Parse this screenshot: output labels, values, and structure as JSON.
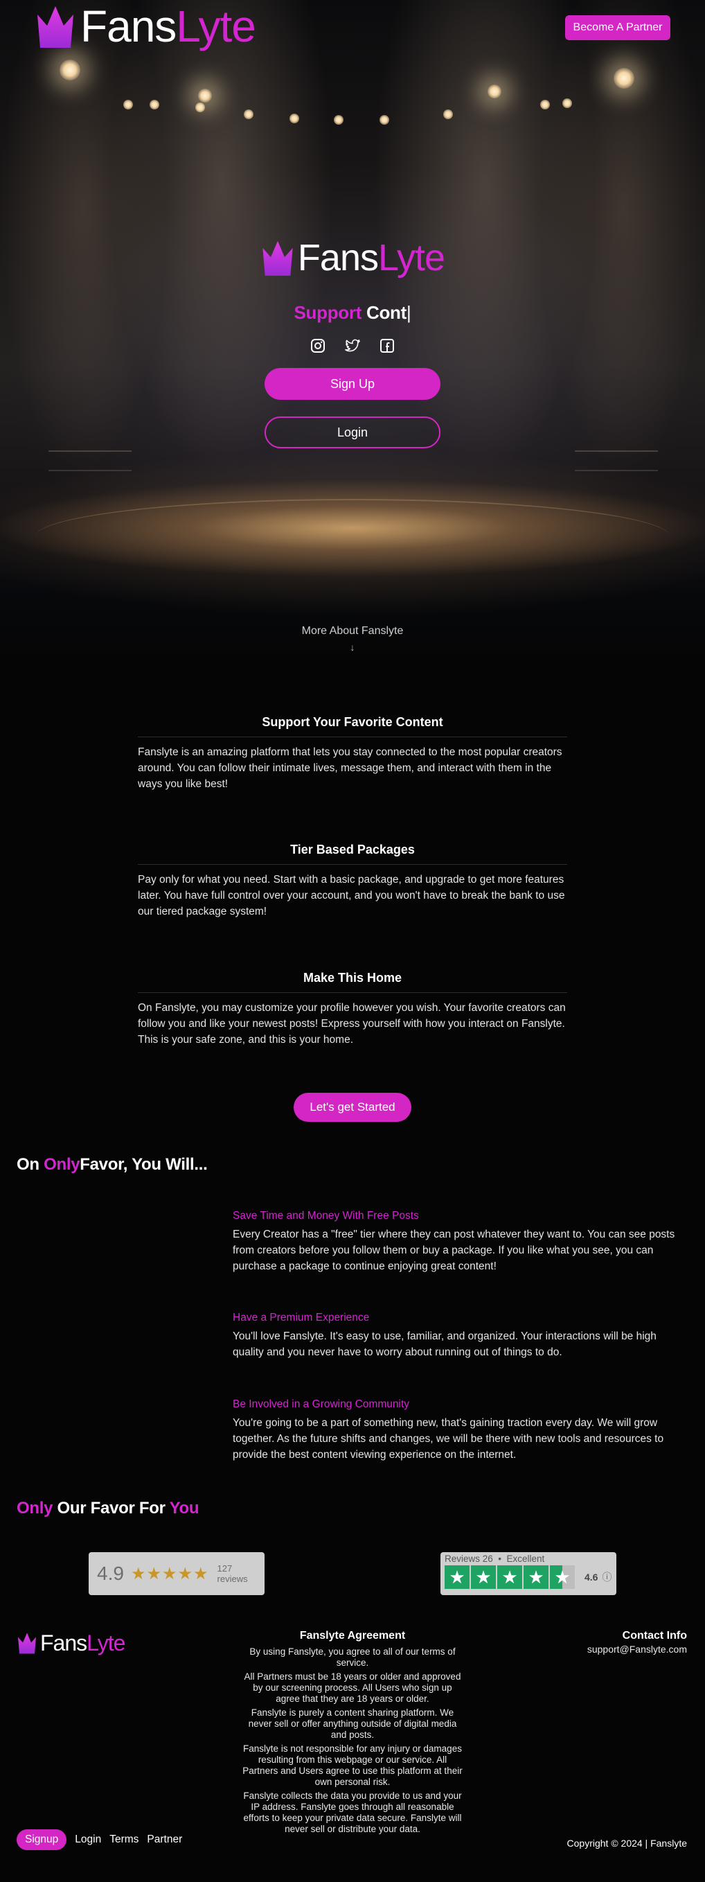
{
  "brand": {
    "part1": "Fans",
    "part2": "Lyte",
    "primary_color": "#d326c4",
    "icon": "crown-icon"
  },
  "header": {
    "partner_button": "Become A Partner"
  },
  "hero": {
    "typing_word1": "Support",
    "typing_word2": "Cont",
    "typing_caret": "|",
    "socials": [
      "instagram-icon",
      "twitter-icon",
      "facebook-icon"
    ],
    "signup_label": "Sign Up",
    "login_label": "Login",
    "more_about": "More About Fanslyte",
    "more_arrow": "↓"
  },
  "features": [
    {
      "title": "Support Your Favorite Content",
      "body": "Fanslyte is an amazing platform that lets you stay connected to the most popular creators around. You can follow their intimate lives, message them, and interact with them in the ways you like best!"
    },
    {
      "title": "Tier Based Packages",
      "body": "Pay only for what you need. Start with a basic package, and upgrade to get more features later. You have full control over your account, and you won't have to break the bank to use our tiered package system!"
    },
    {
      "title": "Make This Home",
      "body": "On Fanslyte, you may customize your profile however you wish. Your favorite creators can follow you and like your newest posts! Express yourself with how you interact on Fanslyte. This is your safe zone, and this is your home."
    }
  ],
  "cta_label": "Let's get Started",
  "section_will": {
    "prefix": "On ",
    "highlight": "Only",
    "suffix": "Favor, You Will..."
  },
  "benefits": [
    {
      "title": "Save Time and Money With Free Posts",
      "body": "Every Creator has a \"free\" tier where they can post whatever they want to. You can see posts from creators before you follow them or buy a package. If you like what you see, you can purchase a package to continue enjoying great content!"
    },
    {
      "title": "Have a Premium Experience",
      "body": "You'll love Fanslyte. It's easy to use, familiar, and organized. Your interactions will be high quality and you never have to worry about running out of things to do."
    },
    {
      "title": "Be Involved in a Growing Community",
      "body": "You're going to be a part of something new, that's gaining traction every day. We will grow together. As the future shifts and changes, we will be there with new tools and resources to provide the best content viewing experience on the internet."
    }
  ],
  "section_favor": {
    "highlight1": "Only",
    "middle": " Our Favor For ",
    "highlight2": "You"
  },
  "reviews": {
    "widget1": {
      "score": "4.9",
      "stars": "★★★★★",
      "count": "127 reviews"
    },
    "widget2": {
      "meta": "Reviews 26  •  Excellent",
      "rating": "4.6",
      "info": "ⓘ"
    }
  },
  "footer": {
    "agreement_title": "Fanslyte Agreement",
    "agreement_paragraphs": [
      "By using Fanslyte, you agree to all of our terms of service.",
      "All Partners must be 18 years or older and approved by our screening process. All Users who sign up agree that they are 18 years or older.",
      "Fanslyte is purely a content sharing platform. We never sell or offer anything outside of digital media and posts.",
      "Fanslyte is not responsible for any injury or damages resulting from this webpage or our service. All Partners and Users agree to use this platform at their own personal risk.",
      "Fanslyte collects the data you provide to us and your IP address. Fanslyte goes through all reasonable efforts to keep your private data secure. Fanslyte will never sell or distribute your data."
    ],
    "contact_title": "Contact Info",
    "contact_email": "support@Fanslyte.com",
    "nav": {
      "signup": "Signup",
      "login": "Login",
      "terms": "Terms",
      "partner": "Partner"
    },
    "copyright": "Copyright © 2024 | Fanslyte"
  }
}
